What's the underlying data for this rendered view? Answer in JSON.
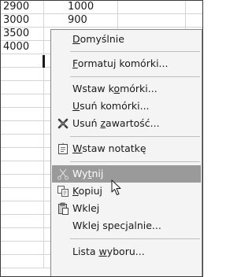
{
  "sheet": {
    "rows": [
      {
        "a": "2900",
        "b": "1000"
      },
      {
        "a": "3000",
        "b": "900"
      },
      {
        "a": "3500",
        "b": ""
      },
      {
        "a": "4000",
        "b": ""
      }
    ]
  },
  "menu": {
    "domyslnie": {
      "pre": "",
      "u": "D",
      "post": "omyślnie"
    },
    "formatuj": {
      "pre": "",
      "u": "F",
      "post": "ormatuj komórki..."
    },
    "wstaw_komorki": {
      "pre": "Wstaw k",
      "u": "o",
      "post": "mórki..."
    },
    "usun_komorki": {
      "pre": "",
      "u": "U",
      "post": "suń komórki..."
    },
    "usun_zawartosc": {
      "pre": "Usuń ",
      "u": "z",
      "post": "awartość..."
    },
    "wstaw_notatke": {
      "pre": "",
      "u": "W",
      "post": "staw notatkę"
    },
    "wytnij": {
      "pre": "Wy",
      "u": "t",
      "post": "nij"
    },
    "kopiuj": {
      "pre": "",
      "u": "K",
      "post": "opiuj"
    },
    "wklej": {
      "pre": "Wklej",
      "u": "",
      "post": ""
    },
    "wklej_specjalnie": {
      "pre": "Wklej spec",
      "u": "j",
      "post": "alnie..."
    },
    "lista_wyboru": {
      "pre": "Lista ",
      "u": "w",
      "post": "yboru..."
    }
  }
}
